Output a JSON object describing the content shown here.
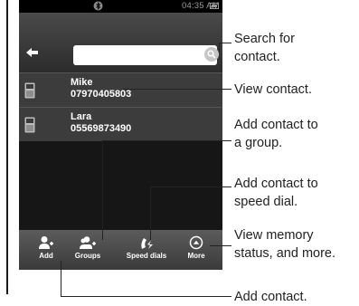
{
  "phone": {
    "status": {
      "time": "04:35 AM",
      "icons": [
        "bluetooth-icon",
        "battery-icon"
      ]
    },
    "search": {
      "placeholder": "",
      "back_icon": "back-arrow-icon",
      "search_icon": "search-icon"
    },
    "contacts": [
      {
        "name": "Mike",
        "number": "07970405803",
        "icon": "phone-icon"
      },
      {
        "name": "Lara",
        "number": "05569873490",
        "icon": "phone-icon"
      }
    ],
    "toolbar": [
      {
        "label": "Add",
        "icon": "add-contact-icon"
      },
      {
        "label": "Groups",
        "icon": "add-group-icon"
      },
      {
        "label": "Speed dials",
        "icon": "speed-dial-icon"
      },
      {
        "label": "More",
        "icon": "more-icon"
      }
    ]
  },
  "callouts": {
    "search_line1": "Search for",
    "search_line2": "contact.",
    "view": "View contact.",
    "group_line1": "Add contact to",
    "group_line2": "a group.",
    "speed_line1": "Add contact to",
    "speed_line2": "speed dial.",
    "memory_line1": "View memory",
    "memory_line2": "status, and more.",
    "add": "Add contact."
  },
  "colors": {
    "screen_bg": "#000000",
    "row_bg": "#3c3c3c",
    "toolbar_bg": "#4a4a4a",
    "text": "#ffffff"
  }
}
